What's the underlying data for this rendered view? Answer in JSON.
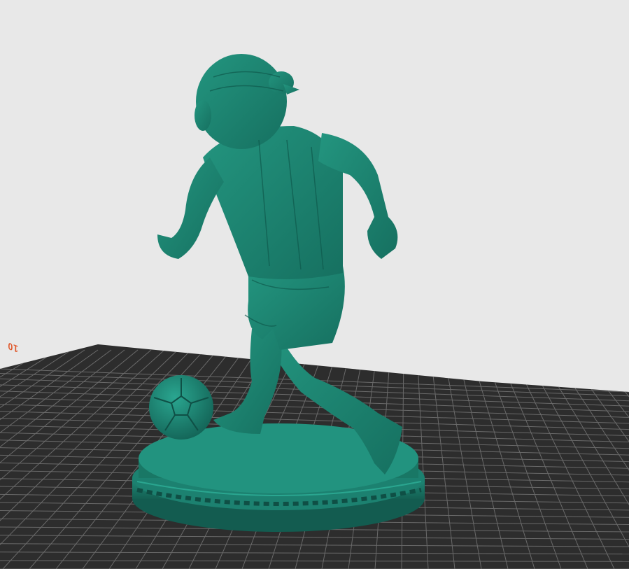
{
  "viewport": {
    "background_color": "#e8e8e8",
    "build_plate_color": "#2d2d2d",
    "grid_line_color": "#6a6a6a",
    "model_color": "#1f8a78",
    "model_shade_color": "#166b5d",
    "axis_label_color": "#e0572a"
  },
  "build_plate": {
    "axis_label": "10"
  },
  "model": {
    "icon": "soccer-player-figurine"
  }
}
